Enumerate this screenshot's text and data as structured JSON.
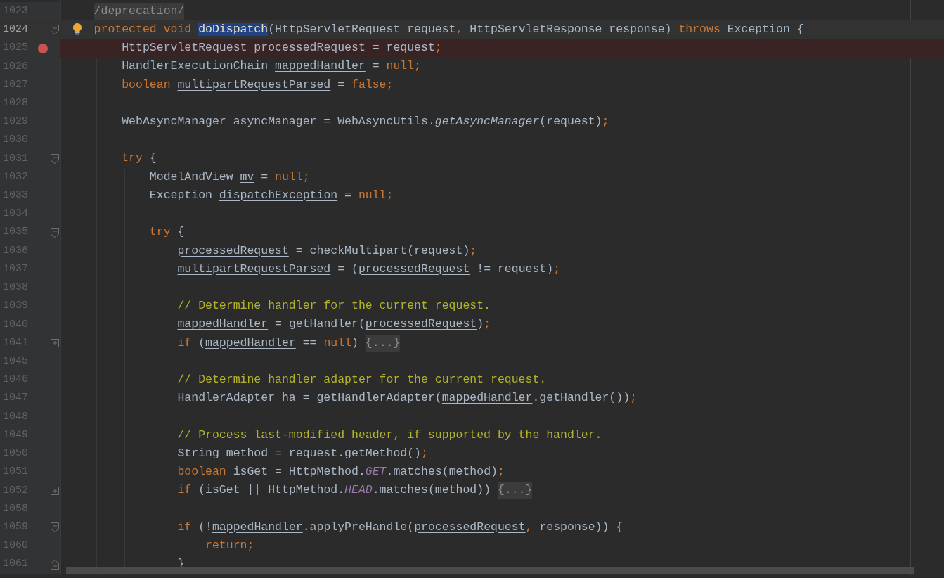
{
  "editor": {
    "lines": [
      {
        "number": "1023",
        "kind": "plain",
        "current": false,
        "breakpoint": false,
        "bulb": false,
        "tokens": [
          {
            "kind": "fold",
            "text": "    /deprecation/"
          }
        ]
      },
      {
        "number": "1024",
        "kind": "fold_start",
        "current": true,
        "breakpoint": false,
        "bulb": true,
        "tokens": [
          {
            "kind": "kw",
            "text": "    protected void "
          },
          {
            "kind": "match",
            "text": "doDispatch"
          },
          {
            "kind": "plain",
            "text": "(HttpServletRequest request"
          },
          {
            "kind": "kw",
            "text": ", "
          },
          {
            "kind": "plain",
            "text": "HttpServletResponse response) "
          },
          {
            "kind": "kw",
            "text": "throws "
          },
          {
            "kind": "plain",
            "text": "Exception {"
          }
        ]
      },
      {
        "number": "1025",
        "kind": "plain",
        "current": false,
        "breakpoint": true,
        "bulb": false,
        "tokens": [
          {
            "kind": "plain",
            "text": "        HttpServletRequest "
          },
          {
            "kind": "var",
            "text": "processedRequest"
          },
          {
            "kind": "plain",
            "text": " = request"
          },
          {
            "kind": "kw",
            "text": ";"
          }
        ]
      },
      {
        "number": "1026",
        "kind": "plain",
        "current": false,
        "breakpoint": false,
        "bulb": false,
        "tokens": [
          {
            "kind": "plain",
            "text": "        HandlerExecutionChain "
          },
          {
            "kind": "var",
            "text": "mappedHandler"
          },
          {
            "kind": "plain",
            "text": " = "
          },
          {
            "kind": "kw",
            "text": "null;"
          }
        ]
      },
      {
        "number": "1027",
        "kind": "plain",
        "current": false,
        "breakpoint": false,
        "bulb": false,
        "tokens": [
          {
            "kind": "kw",
            "text": "        boolean "
          },
          {
            "kind": "var",
            "text": "multipartRequestParsed"
          },
          {
            "kind": "plain",
            "text": " = "
          },
          {
            "kind": "kw",
            "text": "false;"
          }
        ]
      },
      {
        "number": "1028",
        "kind": "plain",
        "current": false,
        "breakpoint": false,
        "bulb": false
      },
      {
        "number": "1029",
        "kind": "plain",
        "current": false,
        "breakpoint": false,
        "bulb": false,
        "tokens": [
          {
            "kind": "plain",
            "text": "        WebAsyncManager asyncManager = WebAsyncUtils."
          },
          {
            "kind": "static_call",
            "text": "getAsyncManager"
          },
          {
            "kind": "plain",
            "text": "(request)"
          },
          {
            "kind": "kw",
            "text": ";"
          }
        ]
      },
      {
        "number": "1030",
        "kind": "plain",
        "current": false,
        "breakpoint": false,
        "bulb": false
      },
      {
        "number": "1031",
        "kind": "fold_start",
        "current": false,
        "breakpoint": false,
        "bulb": false,
        "tokens": [
          {
            "kind": "kw",
            "text": "        try "
          },
          {
            "kind": "plain",
            "text": "{"
          }
        ]
      },
      {
        "number": "1032",
        "kind": "plain",
        "current": false,
        "breakpoint": false,
        "bulb": false,
        "tokens": [
          {
            "kind": "plain",
            "text": "            ModelAndView "
          },
          {
            "kind": "var",
            "text": "mv"
          },
          {
            "kind": "plain",
            "text": " = "
          },
          {
            "kind": "kw",
            "text": "null;"
          }
        ]
      },
      {
        "number": "1033",
        "kind": "plain",
        "current": false,
        "breakpoint": false,
        "bulb": false,
        "tokens": [
          {
            "kind": "plain",
            "text": "            Exception "
          },
          {
            "kind": "var",
            "text": "dispatchException"
          },
          {
            "kind": "plain",
            "text": " = "
          },
          {
            "kind": "kw",
            "text": "null;"
          }
        ]
      },
      {
        "number": "1034",
        "kind": "plain",
        "current": false,
        "breakpoint": false,
        "bulb": false
      },
      {
        "number": "1035",
        "kind": "fold_start",
        "current": false,
        "breakpoint": false,
        "bulb": false,
        "tokens": [
          {
            "kind": "kw",
            "text": "            try "
          },
          {
            "kind": "plain",
            "text": "{"
          }
        ]
      },
      {
        "number": "1036",
        "kind": "plain",
        "current": false,
        "breakpoint": false,
        "bulb": false,
        "tokens": [
          {
            "kind": "var",
            "text": "                processedRequest"
          },
          {
            "kind": "plain",
            "text": " = checkMultipart(request)"
          },
          {
            "kind": "kw",
            "text": ";"
          }
        ]
      },
      {
        "number": "1037",
        "kind": "plain",
        "current": false,
        "breakpoint": false,
        "bulb": false,
        "tokens": [
          {
            "kind": "var",
            "text": "                multipartRequestParsed"
          },
          {
            "kind": "plain",
            "text": " = ("
          },
          {
            "kind": "var",
            "text": "processedRequest"
          },
          {
            "kind": "plain",
            "text": " != request)"
          },
          {
            "kind": "kw",
            "text": ";"
          }
        ]
      },
      {
        "number": "1038",
        "kind": "plain",
        "current": false,
        "breakpoint": false,
        "bulb": false
      },
      {
        "number": "1039",
        "kind": "plain",
        "current": false,
        "breakpoint": false,
        "bulb": false,
        "tokens": [
          {
            "kind": "comment",
            "text": "                // Determine handler for the current request."
          }
        ]
      },
      {
        "number": "1040",
        "kind": "plain",
        "current": false,
        "breakpoint": false,
        "bulb": false,
        "tokens": [
          {
            "kind": "var",
            "text": "                mappedHandler"
          },
          {
            "kind": "plain",
            "text": " = getHandler("
          },
          {
            "kind": "var",
            "text": "processedRequest"
          },
          {
            "kind": "plain",
            "text": ")"
          },
          {
            "kind": "kw",
            "text": ";"
          }
        ]
      },
      {
        "number": "1041",
        "kind": "collapsed",
        "current": false,
        "breakpoint": false,
        "bulb": false,
        "tokens": [
          {
            "kind": "kw",
            "text": "                if "
          },
          {
            "kind": "plain",
            "text": "("
          },
          {
            "kind": "var",
            "text": "mappedHandler"
          },
          {
            "kind": "plain",
            "text": " == "
          },
          {
            "kind": "kw",
            "text": "null"
          },
          {
            "kind": "plain",
            "text": ") "
          },
          {
            "kind": "fold",
            "text": "{...}"
          }
        ]
      },
      {
        "number": "1045",
        "kind": "plain",
        "current": false,
        "breakpoint": false,
        "bulb": false
      },
      {
        "number": "1046",
        "kind": "plain",
        "current": false,
        "breakpoint": false,
        "bulb": false,
        "tokens": [
          {
            "kind": "comment",
            "text": "                // Determine handler adapter for the current request."
          }
        ]
      },
      {
        "number": "1047",
        "kind": "plain",
        "current": false,
        "breakpoint": false,
        "bulb": false,
        "tokens": [
          {
            "kind": "plain",
            "text": "                HandlerAdapter ha = getHandlerAdapter("
          },
          {
            "kind": "var",
            "text": "mappedHandler"
          },
          {
            "kind": "plain",
            "text": ".getHandler())"
          },
          {
            "kind": "kw",
            "text": ";"
          }
        ]
      },
      {
        "number": "1048",
        "kind": "plain",
        "current": false,
        "breakpoint": false,
        "bulb": false
      },
      {
        "number": "1049",
        "kind": "plain",
        "current": false,
        "breakpoint": false,
        "bulb": false,
        "tokens": [
          {
            "kind": "comment",
            "text": "                // Process last-modified header, if supported by the handler."
          }
        ]
      },
      {
        "number": "1050",
        "kind": "plain",
        "current": false,
        "breakpoint": false,
        "bulb": false,
        "tokens": [
          {
            "kind": "plain",
            "text": "                String method = request.getMethod()"
          },
          {
            "kind": "kw",
            "text": ";"
          }
        ]
      },
      {
        "number": "1051",
        "kind": "plain",
        "current": false,
        "breakpoint": false,
        "bulb": false,
        "tokens": [
          {
            "kind": "kw",
            "text": "                boolean "
          },
          {
            "kind": "plain",
            "text": "isGet = HttpMethod."
          },
          {
            "kind": "const",
            "text": "GET"
          },
          {
            "kind": "plain",
            "text": ".matches(method)"
          },
          {
            "kind": "kw",
            "text": ";"
          }
        ]
      },
      {
        "number": "1052",
        "kind": "collapsed",
        "current": false,
        "breakpoint": false,
        "bulb": false,
        "tokens": [
          {
            "kind": "kw",
            "text": "                if "
          },
          {
            "kind": "plain",
            "text": "(isGet || HttpMethod."
          },
          {
            "kind": "const",
            "text": "HEAD"
          },
          {
            "kind": "plain",
            "text": ".matches(method)) "
          },
          {
            "kind": "fold",
            "text": "{...}"
          }
        ]
      },
      {
        "number": "1058",
        "kind": "plain",
        "current": false,
        "breakpoint": false,
        "bulb": false
      },
      {
        "number": "1059",
        "kind": "fold_start",
        "current": false,
        "breakpoint": false,
        "bulb": false,
        "tokens": [
          {
            "kind": "kw",
            "text": "                if "
          },
          {
            "kind": "plain",
            "text": "(!"
          },
          {
            "kind": "var",
            "text": "mappedHandler"
          },
          {
            "kind": "plain",
            "text": ".applyPreHandle("
          },
          {
            "kind": "var",
            "text": "processedRequest"
          },
          {
            "kind": "kw",
            "text": ", "
          },
          {
            "kind": "plain",
            "text": "response)) {"
          }
        ]
      },
      {
        "number": "1060",
        "kind": "plain",
        "current": false,
        "breakpoint": false,
        "bulb": false,
        "tokens": [
          {
            "kind": "kw",
            "text": "                    return;"
          }
        ]
      },
      {
        "number": "1061",
        "kind": "fold_end",
        "current": false,
        "breakpoint": false,
        "bulb": false,
        "tokens": [
          {
            "kind": "plain",
            "text": "                }"
          }
        ]
      }
    ]
  }
}
